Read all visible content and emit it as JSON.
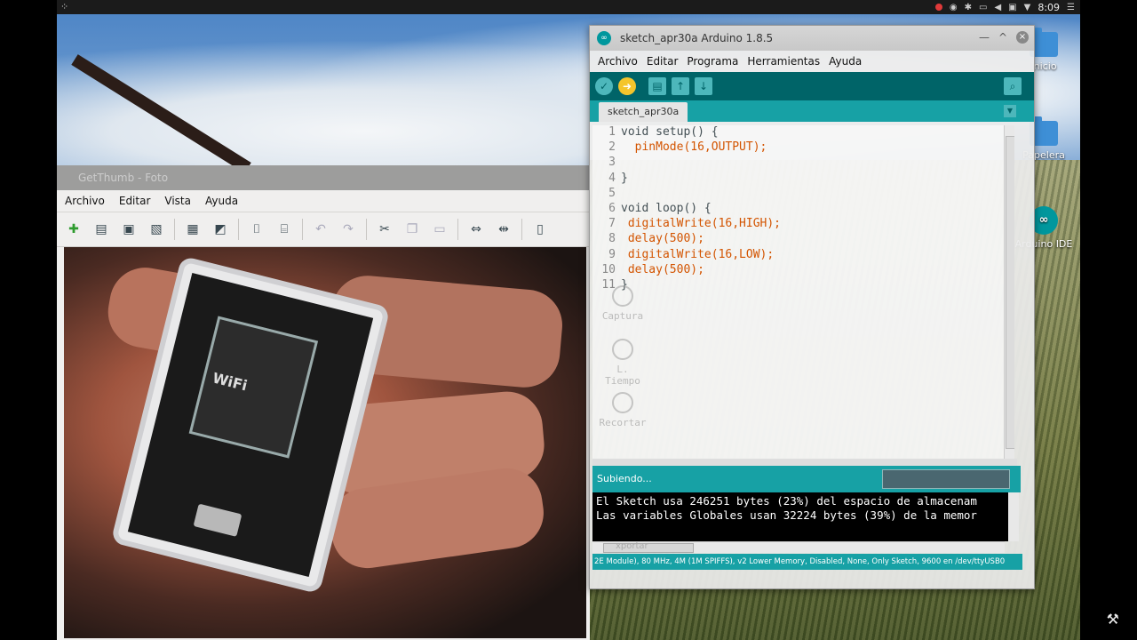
{
  "topbar": {
    "clock": "8:09"
  },
  "desktop": {
    "icons": [
      {
        "label": "Inicio"
      },
      {
        "label": "Papelera"
      },
      {
        "label": "Arduino IDE"
      }
    ]
  },
  "viewer": {
    "title": "GetThumb - Foto",
    "menu": [
      "Archivo",
      "Editar",
      "Vista",
      "Ayuda"
    ],
    "photo": {
      "board_text": "WiFi"
    }
  },
  "arduino": {
    "title": "sketch_apr30a Arduino 1.8.5",
    "menu": [
      "Archivo",
      "Editar",
      "Programa",
      "Herramientas",
      "Ayuda"
    ],
    "tab": "sketch_apr30a",
    "code": [
      {
        "n": "1",
        "text": "void setup() {"
      },
      {
        "n": "2",
        "text": "  pinMode(16,OUTPUT);"
      },
      {
        "n": "3",
        "text": ""
      },
      {
        "n": "4",
        "text": "}"
      },
      {
        "n": "5",
        "text": ""
      },
      {
        "n": "6",
        "text": "void loop() {"
      },
      {
        "n": "7",
        "text": " digitalWrite(16,HIGH);"
      },
      {
        "n": "8",
        "text": " delay(500);"
      },
      {
        "n": "9",
        "text": " digitalWrite(16,LOW);"
      },
      {
        "n": "10",
        "text": " delay(500);"
      },
      {
        "n": "11",
        "text": "}"
      }
    ],
    "status": "Subiendo...",
    "console": [
      "El Sketch usa 246251 bytes (23%) del espacio de almacenam",
      "Las variables Globales usan 32224 bytes (39%) de la memor"
    ],
    "footer": "2E Module), 80 MHz, 4M (1M SPIFFS), v2 Lower Memory, Disabled, None, Only Sketch, 9600 en /dev/ttyUSB0",
    "ghost_buttons": [
      "Captura",
      "L. Tiempo",
      "Recortar",
      "xportar"
    ]
  }
}
